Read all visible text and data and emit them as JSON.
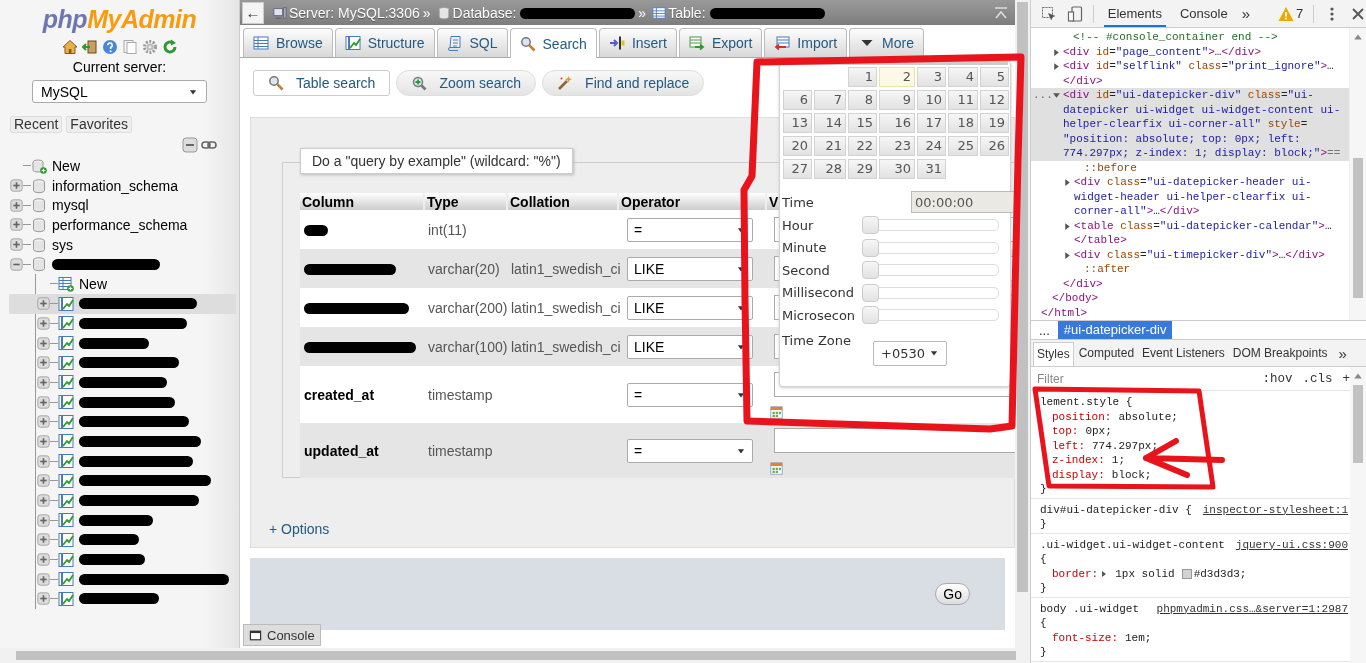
{
  "sidebar": {
    "logo": {
      "part_1": "php",
      "part_2": "MyAdmin"
    },
    "current_server_label": "Current server:",
    "server_select": {
      "value": "MySQL"
    },
    "buttons": [
      {
        "label": "Recent"
      },
      {
        "label": "Favorites"
      }
    ],
    "tree": [
      {
        "kind": "new",
        "label": "New",
        "redacted": false
      },
      {
        "kind": "database",
        "label": "information_schema",
        "redacted": false,
        "expanded": false
      },
      {
        "kind": "database",
        "label": "mysql",
        "redacted": false,
        "expanded": false
      },
      {
        "kind": "database",
        "label": "performance_schema",
        "redacted": false,
        "expanded": false
      },
      {
        "kind": "database",
        "label": "sys",
        "redacted": false,
        "expanded": false
      },
      {
        "kind": "database",
        "redacted": true,
        "expanded": true,
        "children": [
          {
            "kind": "new",
            "label": "New",
            "redacted": false,
            "selected": false
          },
          {
            "kind": "table",
            "redacted": true,
            "selected": true,
            "expanded": false
          },
          {
            "kind": "table",
            "redacted": true,
            "selected": false,
            "expanded": false
          },
          {
            "kind": "table",
            "redacted": true,
            "selected": false,
            "expanded": false
          },
          {
            "kind": "table",
            "redacted": true,
            "selected": false,
            "expanded": false
          },
          {
            "kind": "table",
            "redacted": true,
            "selected": false,
            "expanded": false
          },
          {
            "kind": "table",
            "redacted": true,
            "selected": false,
            "expanded": false
          },
          {
            "kind": "table",
            "redacted": true,
            "selected": false,
            "expanded": false
          },
          {
            "kind": "table",
            "redacted": true,
            "selected": false,
            "expanded": false
          },
          {
            "kind": "table",
            "redacted": true,
            "selected": false,
            "expanded": false
          },
          {
            "kind": "table",
            "redacted": true,
            "selected": false,
            "expanded": false
          },
          {
            "kind": "table",
            "redacted": true,
            "selected": false,
            "expanded": false
          },
          {
            "kind": "table",
            "redacted": true,
            "selected": false,
            "expanded": false
          },
          {
            "kind": "table",
            "redacted": true,
            "selected": false,
            "expanded": false
          },
          {
            "kind": "table",
            "redacted": true,
            "selected": false,
            "expanded": false
          },
          {
            "kind": "table",
            "redacted": true,
            "selected": false,
            "expanded": false
          },
          {
            "kind": "table",
            "redacted": true,
            "selected": false,
            "expanded": false
          }
        ]
      }
    ]
  },
  "breadcrumb": {
    "back": "←",
    "items": [
      {
        "kind": "server",
        "label": "Server: MySQL:3306",
        "redacted": false,
        "separator": "»"
      },
      {
        "kind": "database",
        "label": "Database:",
        "redacted": true,
        "separator": "»"
      },
      {
        "kind": "table",
        "label": "Table:",
        "redacted": true
      }
    ]
  },
  "tabs": [
    {
      "kind": "browse",
      "label": "Browse",
      "selected": false
    },
    {
      "kind": "structure",
      "label": "Structure",
      "selected": false
    },
    {
      "kind": "sql",
      "label": "SQL",
      "selected": false
    },
    {
      "kind": "search",
      "label": "Search",
      "selected": true
    },
    {
      "kind": "insert",
      "label": "Insert",
      "selected": false
    },
    {
      "kind": "export",
      "label": "Export",
      "selected": false
    },
    {
      "kind": "import",
      "label": "Import",
      "selected": false
    },
    {
      "kind": "more",
      "label": "More",
      "selected": false
    }
  ],
  "subtabs": [
    {
      "kind": "search",
      "label": "Table search",
      "selected": true
    },
    {
      "kind": "zoom",
      "label": "Zoom search",
      "selected": false
    },
    {
      "kind": "replace",
      "label": "Find and replace",
      "selected": false
    }
  ],
  "search_form": {
    "legend": "Do a \"query by example\" (wildcard: \"%\")",
    "columns": [
      "Column",
      "Type",
      "Collation",
      "Operator",
      "V"
    ],
    "rows": [
      {
        "redacted": true,
        "type": "int(11)",
        "operator": "=",
        "date_picker": false
      },
      {
        "redacted": true,
        "type": "varchar(20)",
        "collation": "latin1_swedish_ci",
        "operator": "LIKE",
        "date_picker": false
      },
      {
        "redacted": true,
        "type": "varchar(200)",
        "collation": "latin1_swedish_ci",
        "operator": "LIKE",
        "date_picker": false
      },
      {
        "redacted": true,
        "type": "varchar(100)",
        "collation": "latin1_swedish_ci",
        "operator": "LIKE",
        "date_picker": false
      },
      {
        "redacted": false,
        "name": "created_at",
        "type": "timestamp",
        "operator": "=",
        "date_picker": true
      },
      {
        "redacted": false,
        "name": "updated_at",
        "type": "timestamp",
        "operator": "=",
        "date_picker": true
      }
    ],
    "options_link": "+ Options",
    "go_button": "Go"
  },
  "datepicker": {
    "weeks": [
      [
        {
          "label": "1",
          "today": false
        },
        {
          "label": "2",
          "today": true
        },
        {
          "label": "3",
          "today": false
        },
        {
          "label": "4",
          "today": false
        },
        {
          "label": "5",
          "today": false
        }
      ],
      [
        {
          "label": "6",
          "today": false
        },
        {
          "label": "7",
          "today": false
        },
        {
          "label": "8",
          "today": false
        },
        {
          "label": "9",
          "today": false
        },
        {
          "label": "10",
          "today": false
        },
        {
          "label": "11",
          "today": false
        },
        {
          "label": "12",
          "today": false
        }
      ],
      [
        {
          "label": "13",
          "today": false
        },
        {
          "label": "14",
          "today": false
        },
        {
          "label": "15",
          "today": false
        },
        {
          "label": "16",
          "today": false
        },
        {
          "label": "17",
          "today": false
        },
        {
          "label": "18",
          "today": false
        },
        {
          "label": "19",
          "today": false
        }
      ],
      [
        {
          "label": "20",
          "today": false
        },
        {
          "label": "21",
          "today": false
        },
        {
          "label": "22",
          "today": false
        },
        {
          "label": "23",
          "today": false
        },
        {
          "label": "24",
          "today": false
        },
        {
          "label": "25",
          "today": false
        },
        {
          "label": "26",
          "today": false
        }
      ],
      [
        {
          "label": "27",
          "today": false
        },
        {
          "label": "28",
          "today": false
        },
        {
          "label": "29",
          "today": false
        },
        {
          "label": "30",
          "today": false
        },
        {
          "label": "31",
          "today": false
        }
      ]
    ],
    "time": {
      "label": "Time",
      "value": "00:00:00"
    },
    "sliders": [
      {
        "label": "Hour",
        "level": 0
      },
      {
        "label": "Minute",
        "level": 0
      },
      {
        "label": "Second",
        "level": 0
      },
      {
        "label": "Millisecond",
        "level": 0
      },
      {
        "label": "Microsecon",
        "level": 0
      }
    ],
    "timezone": {
      "label": "Time Zone",
      "value": "+0530"
    }
  },
  "console_tab": "Console",
  "devtools": {
    "toolbar": {
      "tabs": [
        {
          "label": "Elements",
          "selected": true
        },
        {
          "label": "Console",
          "selected": false
        }
      ],
      "more": "»",
      "warnings": "7"
    },
    "dom_tree": [
      {
        "closing": "</html>",
        "children": [
          {
            "closing": "</body>",
            "children": [
              {
                "kind": "comment",
                "lines": [
                  "<!-- #console_container end -->"
                ]
              },
              {
                "kind": "element",
                "expanded": false,
                "selected": false,
                "lines": [
                  "<div id=\"page_content\">…</div>"
                ]
              },
              {
                "kind": "element",
                "expanded": false,
                "selected": false,
                "lines": [
                  "<div id=\"selflink\" class=\"print_ignore\">…",
                  "</div>"
                ]
              },
              {
                "kind": "element",
                "expanded": true,
                "selected": true,
                "gutter": "...",
                "marker": "==",
                "lines": [
                  "<div id=\"ui-datepicker-div\" class=\"ui-",
                  "datepicker ui-widget ui-widget-content ui-",
                  "helper-clearfix ui-corner-all\" style=",
                  "\"position: absolute; top: 0px; left:",
                  "774.297px; z-index: 1; display: block;\">"
                ],
                "closing": "</div>",
                "children": [
                  {
                    "kind": "pseudo",
                    "lines": [
                      "::before"
                    ]
                  },
                  {
                    "kind": "element",
                    "expanded": false,
                    "selected": false,
                    "lines": [
                      "<div class=\"ui-datepicker-header ui-",
                      "widget-header ui-helper-clearfix ui-",
                      "corner-all\">…</div>"
                    ]
                  },
                  {
                    "kind": "element",
                    "expanded": false,
                    "selected": false,
                    "lines": [
                      "<table class=\"ui-datepicker-calendar\">…",
                      "</table>"
                    ]
                  },
                  {
                    "kind": "element",
                    "expanded": false,
                    "selected": false,
                    "lines": [
                      "<div class=\"ui-timepicker-div\">…</div>"
                    ]
                  },
                  {
                    "kind": "pseudo",
                    "lines": [
                      "::after"
                    ]
                  }
                ]
              }
            ]
          }
        ]
      }
    ],
    "path_bar": {
      "more": "...",
      "items": [
        {
          "label": "#ui-datepicker-div",
          "selected": true
        }
      ]
    },
    "styles": {
      "tabs": [
        {
          "label": "Styles",
          "selected": true
        },
        {
          "label": "Computed",
          "selected": false
        },
        {
          "label": "Event Listeners",
          "selected": false
        },
        {
          "label": "DOM Breakpoints",
          "selected": false
        }
      ],
      "more": "»",
      "filter": {
        "placeholder": "Filter"
      },
      "buttons": [
        ":hov",
        ".cls",
        "+"
      ],
      "rules": [
        {
          "selector": "lement.style {",
          "props": [
            {
              "name": "position:",
              "value": "absolute;"
            },
            {
              "name": "top:",
              "value": "0px;"
            },
            {
              "name": "left:",
              "value": "774.297px;"
            },
            {
              "name": "z-index:",
              "value": "1;"
            },
            {
              "name": "display:",
              "value": "block;"
            }
          ],
          "close": "}"
        },
        {
          "selector": "div#ui-datepicker-div {",
          "source": "inspector-stylesheet:1",
          "close": "}"
        },
        {
          "selector": ".ui-widget.ui-widget-content",
          "source": "jquery-ui.css:900",
          "brace": "{",
          "props": [
            {
              "name": "border:",
              "value": "1px solid",
              "expandable": true,
              "swatch": {
                "color": "#d3d3d3",
                "text": "#d3d3d3;"
              }
            }
          ],
          "close": "}"
        },
        {
          "selector": "body .ui-widget",
          "source": "phpmyadmin.css…&server=1:2987",
          "brace": "{",
          "props": [
            {
              "name": "font-size:",
              "value": "1em;"
            }
          ],
          "close": "}"
        }
      ]
    }
  }
}
